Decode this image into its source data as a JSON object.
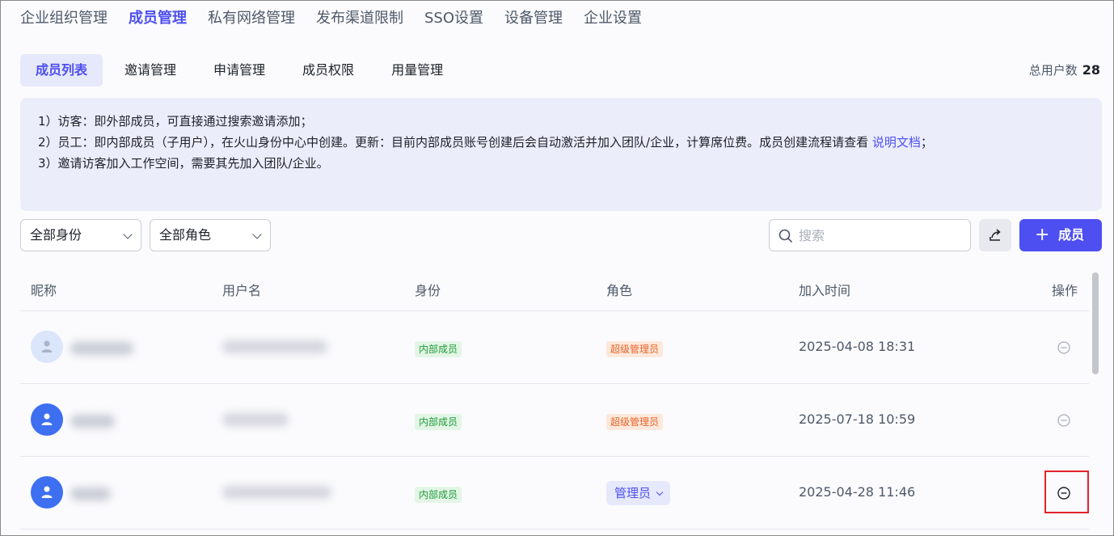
{
  "topnav": {
    "items": [
      "企业组织管理",
      "成员管理",
      "私有网络管理",
      "发布渠道限制",
      "SSO设置",
      "设备管理",
      "企业设置"
    ],
    "active_index": 1
  },
  "subtabs": {
    "items": [
      "成员列表",
      "邀请管理",
      "申请管理",
      "成员权限",
      "用量管理"
    ],
    "active_index": 0
  },
  "user_count": {
    "label": "总用户数",
    "value": "28"
  },
  "notice": {
    "line1": "1）访客：即外部成员，可直接通过搜索邀请添加；",
    "line2_text": "2）员工：即内部成员（子用户），在火山身份中心中创建。更新：目前内部成员账号创建后会自动激活并加入团队/企业，计算席位费。成员创建流程请查看 ",
    "line2_link": "说明文档",
    "line2_end": "；",
    "line3": "3）邀请访客加入工作空间，需要其先加入团队/企业。"
  },
  "filters": {
    "identity": "全部身份",
    "role": "全部角色"
  },
  "search": {
    "placeholder": "搜索"
  },
  "add_button": {
    "label": "成员",
    "icon": "plus-icon"
  },
  "export_button": {
    "icon": "export-icon"
  },
  "table": {
    "headers": [
      "昵称",
      "用户名",
      "身份",
      "角色",
      "加入时间",
      "操作"
    ],
    "rows": [
      {
        "identity": "内部成员",
        "role": "超级管理员",
        "role_type": "tag",
        "joined": "2025-04-08 18:31",
        "avatar": "light"
      },
      {
        "identity": "内部成员",
        "role": "超级管理员",
        "role_type": "tag",
        "joined": "2025-07-18 10:59",
        "avatar": "blue"
      },
      {
        "identity": "内部成员",
        "role": "管理员",
        "role_type": "select",
        "joined": "2025-04-28 11:46",
        "avatar": "blue"
      }
    ]
  },
  "colors": {
    "accent": "#4d4ff0",
    "notice_bg": "#ecedfb",
    "tag_green": "#1f9a3a",
    "tag_orange": "#e8632a",
    "highlight": "#e3232b"
  }
}
